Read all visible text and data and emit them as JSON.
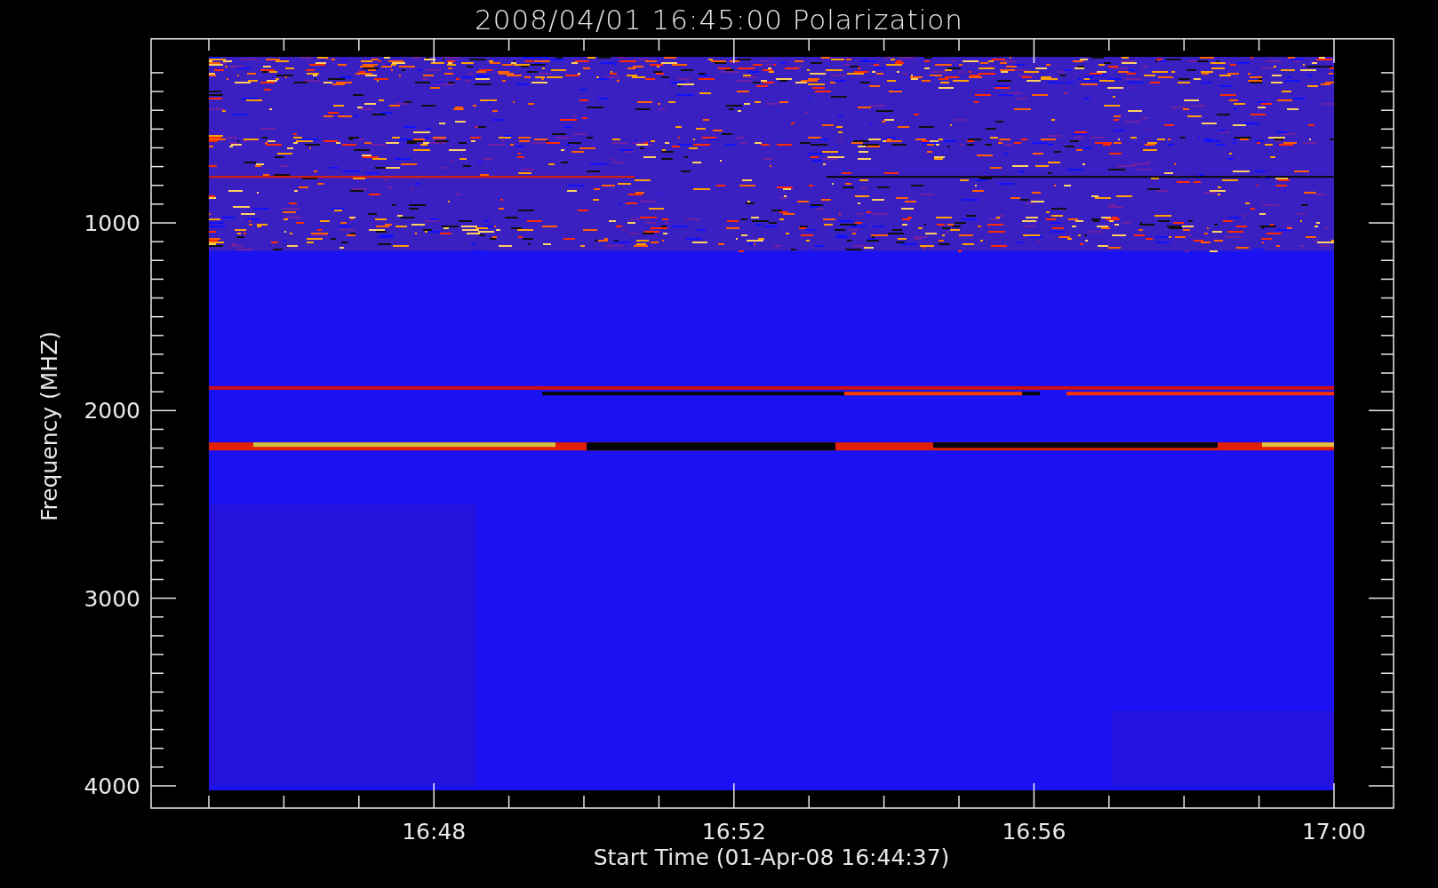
{
  "title": "2008/04/01 16:45:00 Polarization",
  "y_axis": {
    "label": "Frequency (MHZ)",
    "ticks": [
      "1000",
      "2000",
      "3000",
      "4000"
    ]
  },
  "x_axis": {
    "label": "Start Time (01-Apr-08 16:44:37)",
    "ticks": [
      "16:48",
      "16:52",
      "16:56",
      "17:00"
    ]
  }
}
